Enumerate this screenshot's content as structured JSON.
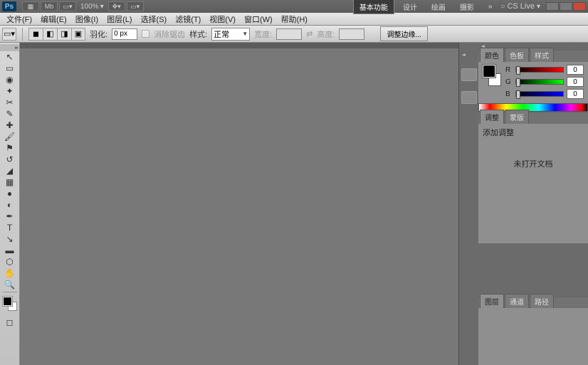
{
  "app": {
    "logo": "Ps",
    "zoom": "100%"
  },
  "workspaces": {
    "items": [
      "基本功能",
      "设计",
      "绘画",
      "摄影"
    ],
    "active": 0,
    "cslive": "CS Live"
  },
  "menu": {
    "items": [
      "文件(F)",
      "编辑(E)",
      "图像(I)",
      "图层(L)",
      "选择(S)",
      "滤镜(T)",
      "视图(V)",
      "窗口(W)",
      "帮助(H)"
    ]
  },
  "options": {
    "feather_label": "羽化:",
    "feather_value": "0 px",
    "antialias_label": "消除锯齿",
    "style_label": "样式:",
    "style_value": "正常",
    "width_label": "宽度:",
    "height_label": "高度:",
    "refine_edges": "调整边缘..."
  },
  "color_panel": {
    "tabs": [
      "颜色",
      "色板",
      "样式"
    ],
    "r_label": "R",
    "r_value": "0",
    "g_label": "G",
    "g_value": "0",
    "b_label": "B",
    "b_value": "0"
  },
  "adjust_panel": {
    "tabs": [
      "调整",
      "蒙版"
    ],
    "add_label": "添加调整",
    "no_doc": "未打开文档"
  },
  "layers_panel": {
    "tabs": [
      "图层",
      "通道",
      "路径"
    ]
  }
}
